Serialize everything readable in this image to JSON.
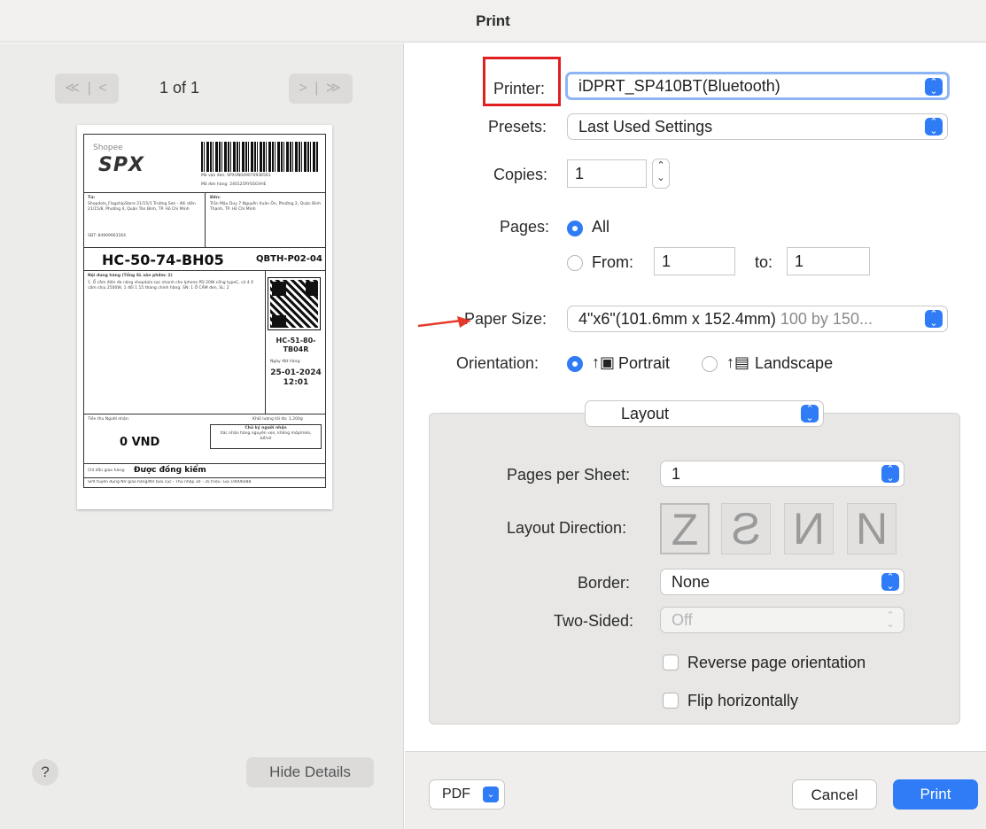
{
  "window": {
    "title": "Print"
  },
  "preview": {
    "page_label": "1 of 1",
    "nav_first_prev": "≪ | <",
    "nav_next_last": "> | ≫",
    "help_label": "?",
    "hide_details_label": "Hide Details"
  },
  "shipping_label": {
    "brand": "Shopee",
    "brand_mark": "SPX",
    "waybill_label": "Mã vận đơn: SPXVN049070936561",
    "order_label": "Mã đơn hàng: 240125RYSSGVHE",
    "from_heading": "Từ:",
    "from_text": "Shopdola_FlagshipStore 21/15/1 Trường Sơn - đối diện 21/15/8, Phường 4, Quận Tân Bình, TP. Hồ Chí Minh",
    "from_phone": "SĐT: 84909903164",
    "to_heading": "Đến:",
    "to_text": "Trần Mậu Duy 7 Nguyễn Xuân Ôn, Phường 2, Quận Bình Thạnh, TP. Hồ Chí Minh",
    "route_code": "HC-50-74-BH05",
    "hub_code": "QBTH-P02-04",
    "contents_heading": "Nội dung hàng (Tổng SL sản phẩm: 2)",
    "contents_text": "1. Ổ cắm điện đa năng shopdola sạc nhanh cho Iphone PD 20W cổng typeC, có 4 ổ cắm chịu 2500W, 1 đổi 1 15 tháng chính hãng. SN: 1 Ổ CẮM đen, SL: 2",
    "sort_code": "HC-51-80-TB04R",
    "order_date_label": "Ngày đặt hàng:",
    "order_date": "25-01-2024",
    "order_time": "12:01",
    "cod_label": "Tiền thu Người nhận:",
    "cod_value": "0 VND",
    "weight_label": "Khối lượng tối đa: 1,200g",
    "signature_heading": "Chữ ký người nhận",
    "signature_note": "Xác nhận hàng nguyên vẹn, không móp/méo, bể/vỡ",
    "inspect_label": "Chỉ dẫn giao hàng:",
    "inspect_value": "Được đồng kiểm",
    "footer_text": "SPX tuyển dụng NV giao hàng/NV bưu cục - Thu nhập 30 - 35 triệu. Gọi 19006088"
  },
  "form": {
    "printer_label": "Printer:",
    "printer_value": "iDPRT_SP410BT(Bluetooth)",
    "presets_label": "Presets:",
    "presets_value": "Last Used Settings",
    "copies_label": "Copies:",
    "copies_value": "1",
    "pages_label": "Pages:",
    "pages_all": "All",
    "pages_from_label": "From:",
    "pages_from_value": "1",
    "pages_to_label": "to:",
    "pages_to_value": "1",
    "paper_size_label": "Paper Size:",
    "paper_size_value": "4\"x6\"(101.6mm x 152.4mm)",
    "paper_size_detail": "100 by 150...",
    "orientation_label": "Orientation:",
    "orientation_portrait": "Portrait",
    "orientation_landscape": "Landscape"
  },
  "layout": {
    "section_value": "Layout",
    "pages_per_sheet_label": "Pages per Sheet:",
    "pages_per_sheet_value": "1",
    "layout_direction_label": "Layout Direction:",
    "layout_directions": [
      "Z",
      "Ƨ",
      "И",
      "N"
    ],
    "border_label": "Border:",
    "border_value": "None",
    "two_sided_label": "Two-Sided:",
    "two_sided_value": "Off",
    "reverse_label": "Reverse page orientation",
    "flip_label": "Flip horizontally"
  },
  "footer": {
    "pdf_label": "PDF",
    "cancel_label": "Cancel",
    "print_label": "Print"
  },
  "colors": {
    "accent": "#2f7cf6",
    "highlight_box": "#e02020",
    "arrow": "#e53a2a"
  }
}
